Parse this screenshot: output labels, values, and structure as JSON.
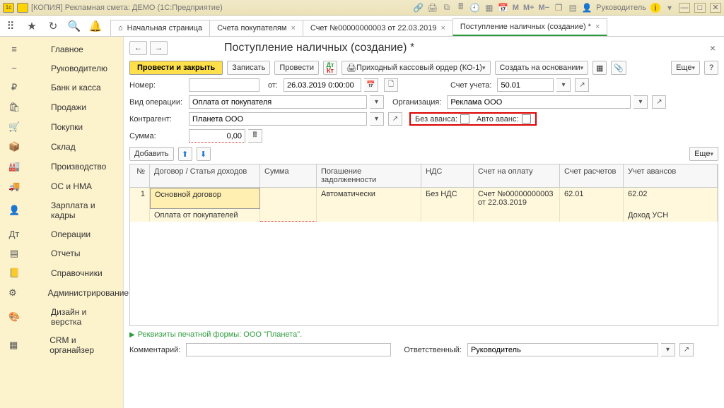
{
  "titlebar": {
    "text": "[КОПИЯ] Рекламная смета: ДЕМО  (1С:Предприятие)",
    "user_label": "Руководитель"
  },
  "tabs": {
    "home": "Начальная страница",
    "t1": "Счета покупателям",
    "t2": "Счет №00000000003 от 22.03.2019",
    "active": "Поступление наличных (создание) *"
  },
  "sidebar": [
    {
      "icon": "≡",
      "label": "Главное"
    },
    {
      "icon": "~",
      "label": "Руководителю"
    },
    {
      "icon": "₽",
      "label": "Банк и касса"
    },
    {
      "icon": "🛍",
      "label": "Продажи"
    },
    {
      "icon": "🛒",
      "label": "Покупки"
    },
    {
      "icon": "📦",
      "label": "Склад"
    },
    {
      "icon": "🏭",
      "label": "Производство"
    },
    {
      "icon": "🚚",
      "label": "ОС и НМА"
    },
    {
      "icon": "👤",
      "label": "Зарплата и кадры"
    },
    {
      "icon": "Дт",
      "label": "Операции"
    },
    {
      "icon": "▤",
      "label": "Отчеты"
    },
    {
      "icon": "📒",
      "label": "Справочники"
    },
    {
      "icon": "⚙",
      "label": "Администрирование"
    },
    {
      "icon": "🎨",
      "label": "Дизайн и верстка"
    },
    {
      "icon": "▦",
      "label": "CRM и органайзер"
    }
  ],
  "page": {
    "title": "Поступление наличных (создание) *",
    "btn_post_close": "Провести и закрыть",
    "btn_write": "Записать",
    "btn_post": "Провести",
    "btn_print": "Приходный кассовый ордер (КО-1)",
    "btn_create": "Создать на основании",
    "btn_more": "Еще"
  },
  "form": {
    "number_label": "Номер:",
    "from_label": "от:",
    "date": "26.03.2019 0:00:00",
    "account_label": "Счет учета:",
    "account": "50.01",
    "op_label": "Вид операции:",
    "op_value": "Оплата от покупателя",
    "org_label": "Организация:",
    "org_value": "Реклама ООО",
    "contr_label": "Контрагент:",
    "contr_value": "Планета ООО",
    "noadv_label": "Без аванса:",
    "autoadv_label": "Авто аванс:",
    "sum_label": "Сумма:",
    "sum_value": "0,00",
    "add_btn": "Добавить"
  },
  "grid": {
    "headers": {
      "n": "№",
      "dog": "Договор / Статья доходов",
      "sum": "Сумма",
      "pog": "Погашение задолженности",
      "nds": "НДС",
      "sch": "Счет на оплату",
      "ras": "Счет расчетов",
      "ava": "Учет авансов"
    },
    "row1": {
      "n": "1",
      "dog": "Основной договор",
      "sum": "",
      "pog": "Автоматически",
      "nds": "Без НДС",
      "sch": "Счет №00000000003 от 22.03.2019",
      "ras": "62.01",
      "ava": "62.02"
    },
    "row2": {
      "dog": "Оплата от покупателей",
      "ava": "Доход УСН"
    }
  },
  "footer": {
    "link": "Реквизиты печатной формы: ООО \"Планета\".",
    "comment_label": "Комментарий:",
    "resp_label": "Ответственный:",
    "resp_value": "Руководитель"
  }
}
